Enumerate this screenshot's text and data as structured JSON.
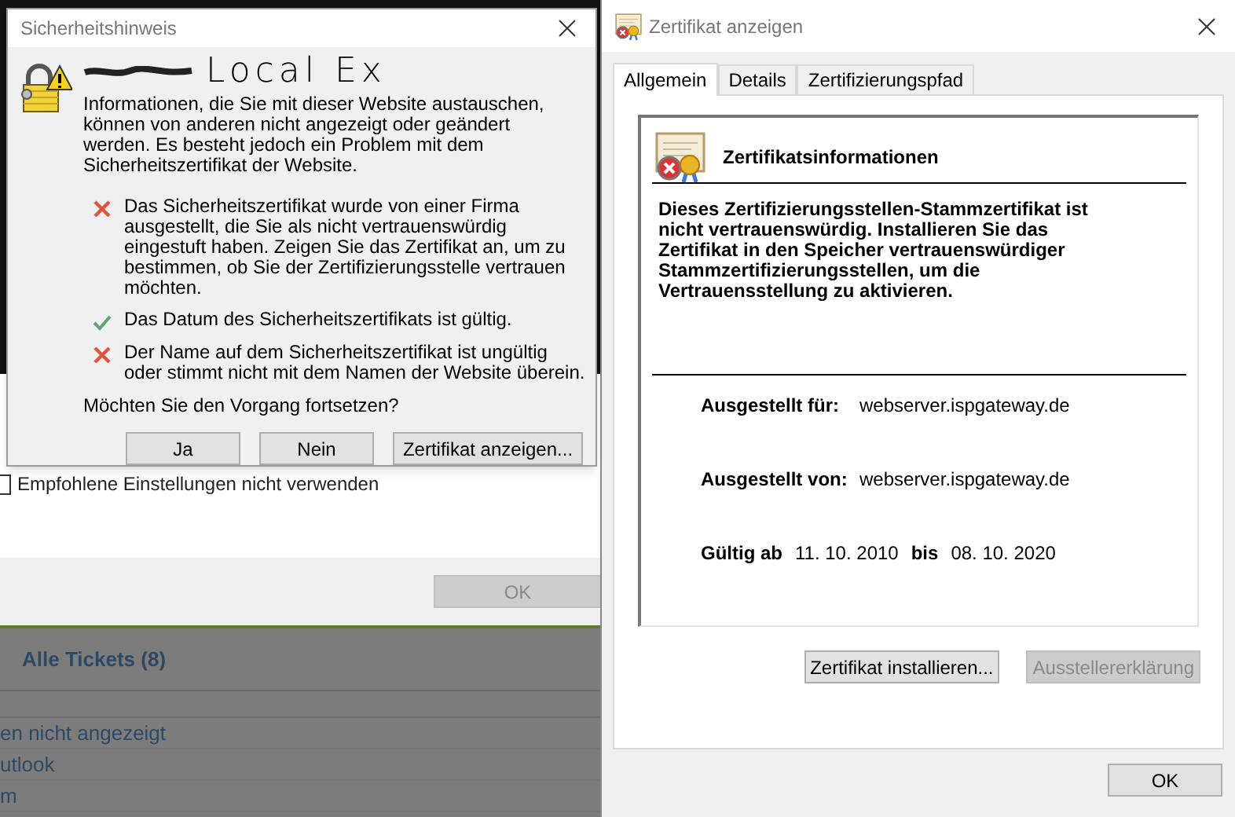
{
  "background_dialog": {
    "checkbox": {
      "label": "Empfohlene Einstellungen nicht verwenden",
      "checked": false
    },
    "ok_button": {
      "label": "OK",
      "disabled": true
    }
  },
  "background_page": {
    "tab": "Alle Tickets (8)",
    "rows": [
      "en nicht angezeigt",
      "utlook",
      "m"
    ]
  },
  "security_dialog": {
    "title": "Sicherheitshinweis",
    "annotation": "Local Ex",
    "message": "Informationen, die Sie mit dieser Website austauschen, können von anderen nicht angezeigt oder geändert werden. Es besteht jedoch ein Problem mit dem Sicherheitszertifikat der Website.",
    "checks": [
      {
        "kind": "fail",
        "text": "Das Sicherheitszertifikat wurde von einer Firma ausgestellt, die Sie als nicht vertrauenswürdig eingestuft haben. Zeigen Sie das Zertifikat an, um zu bestimmen, ob Sie der Zertifizierungsstelle vertrauen möchten."
      },
      {
        "kind": "ok",
        "text": "Das Datum des Sicherheitszertifikats ist gültig."
      },
      {
        "kind": "fail",
        "text": "Der Name auf dem Sicherheitszertifikat ist ungültig oder stimmt nicht mit dem Namen der Website überein."
      }
    ],
    "question": "Möchten Sie den Vorgang fortsetzen?",
    "buttons": [
      "Ja",
      "Nein",
      "Zertifikat anzeigen..."
    ]
  },
  "certificate_window": {
    "title": "Zertifikat anzeigen",
    "tabs": [
      {
        "label": "Allgemein",
        "selected": true
      },
      {
        "label": "Details",
        "selected": false
      },
      {
        "label": "Zertifizierungspfad",
        "selected": false
      }
    ],
    "heading": "Zertifikatsinformationen",
    "warning": "Dieses Zertifizierungsstellen-Stammzertifikat ist nicht vertrauenswürdig. Installieren Sie das Zertifikat in den Speicher vertrauenswürdiger Stammzertifizierungsstellen, um die Vertrauensstellung zu aktivieren.",
    "fields": [
      {
        "label": "Ausgestellt für:",
        "value": "webserver.ispgateway.de"
      },
      {
        "label": "Ausgestellt von:",
        "value": "webserver.ispgateway.de"
      }
    ],
    "validity": {
      "from_label": "Gültig ab",
      "from": "11. 10. 2010",
      "to_label": "bis",
      "to": "08. 10. 2020"
    },
    "buttons": [
      {
        "label": "Zertifikat installieren...",
        "disabled": false
      },
      {
        "label": "Ausstellererklärung",
        "disabled": true
      }
    ],
    "ok_button": "OK"
  }
}
